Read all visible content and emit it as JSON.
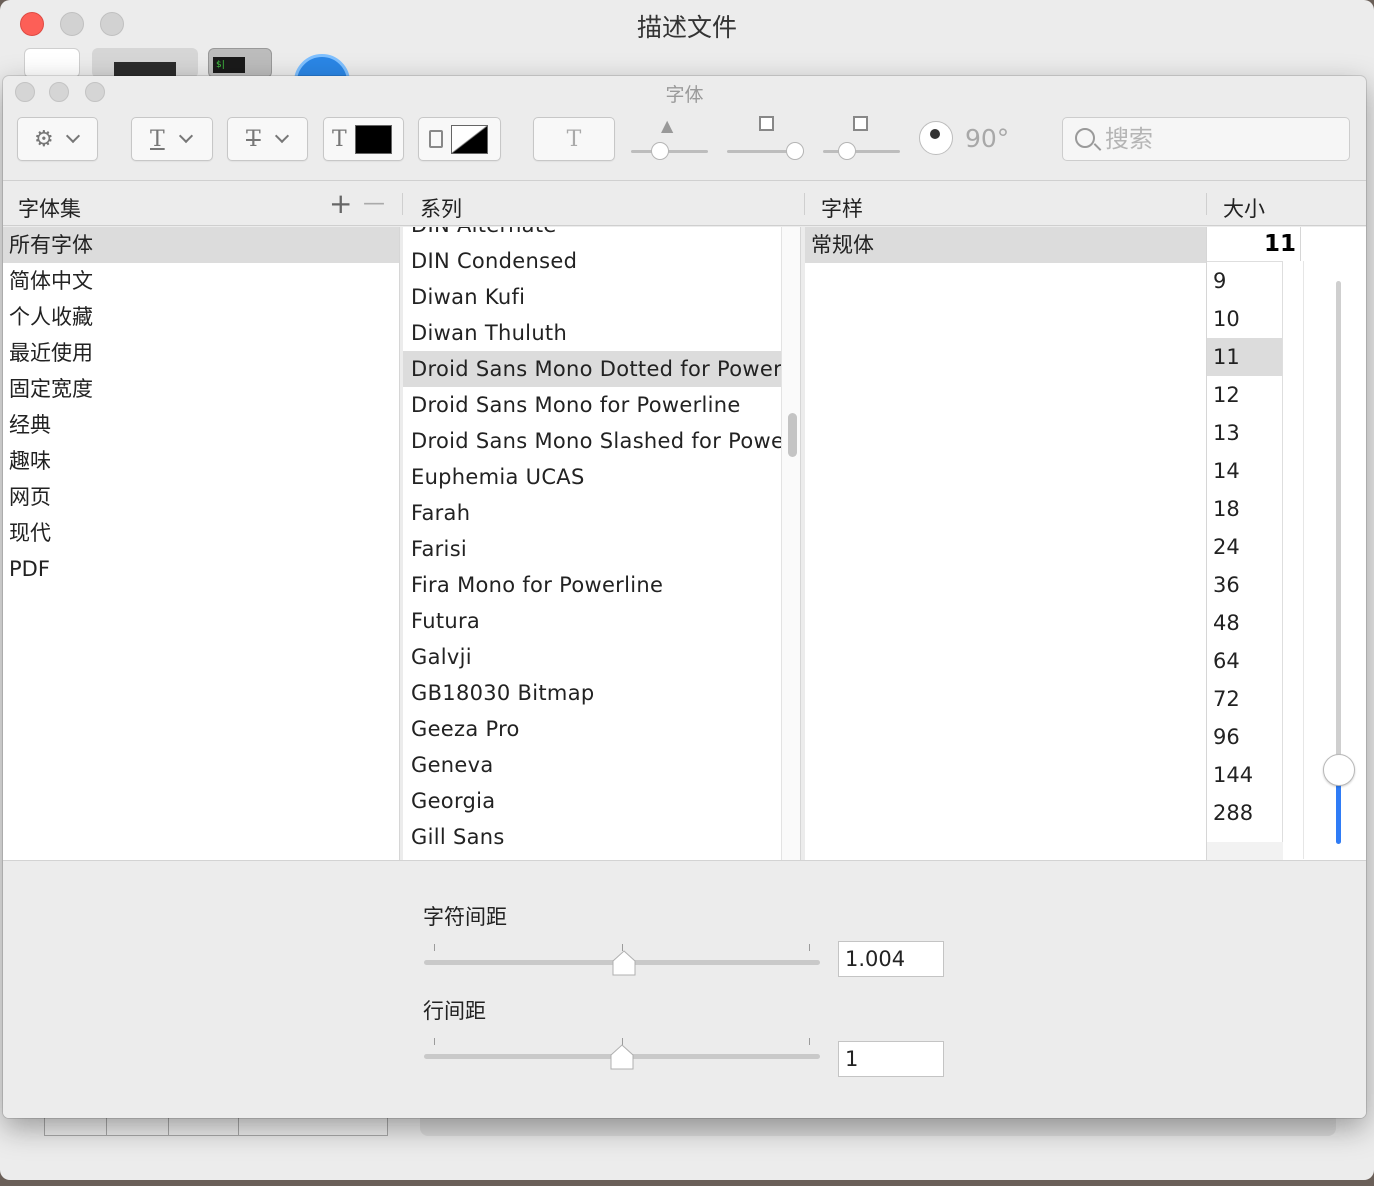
{
  "background_window": {
    "title": "描述文件"
  },
  "font_panel": {
    "title": "字体",
    "toolbar": {
      "rotation_label": "90°",
      "search_placeholder": "搜索"
    },
    "headers": {
      "collections": "字体集",
      "family": "系列",
      "typeface": "字样",
      "size": "大小",
      "add_symbol": "+",
      "remove_symbol": "—"
    },
    "collections": [
      "所有字体",
      "简体中文",
      "个人收藏",
      "最近使用",
      "固定宽度",
      "经典",
      "趣味",
      "网页",
      "现代",
      "PDF"
    ],
    "selected_collection": "所有字体",
    "families": [
      "DIN Alternate",
      "DIN Condensed",
      "Diwan Kufi",
      "Diwan Thuluth",
      "Droid Sans Mono Dotted for Powerline",
      "Droid Sans Mono for Powerline",
      "Droid Sans Mono Slashed for Powerline",
      "Euphemia UCAS",
      "Farah",
      "Farisi",
      "Fira Mono for Powerline",
      "Futura",
      "Galvji",
      "GB18030 Bitmap",
      "Geeza Pro",
      "Geneva",
      "Georgia",
      "Gill Sans"
    ],
    "selected_family": "Droid Sans Mono Dotted for Powerline",
    "typefaces": [
      "常规体"
    ],
    "selected_typeface": "常规体",
    "size_value": "11",
    "sizes": [
      "9",
      "10",
      "11",
      "12",
      "13",
      "14",
      "18",
      "24",
      "36",
      "48",
      "64",
      "72",
      "96",
      "144",
      "288"
    ],
    "selected_size": "11",
    "spacing": {
      "character_label": "字符间距",
      "character_value": "1.004",
      "line_label": "行间距",
      "line_value": "1"
    }
  },
  "colors": {
    "accent": "#2f7cf6",
    "close_button": "#fd5f57",
    "selection": "#dcdcdc"
  },
  "icons": [
    "gear-icon",
    "underline-icon",
    "strikethrough-icon",
    "text-color-icon",
    "document-color-icon",
    "shadow-icon",
    "search-icon",
    "rotation-dial-icon"
  ]
}
